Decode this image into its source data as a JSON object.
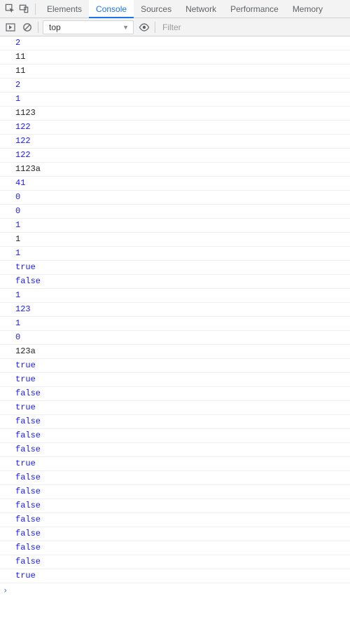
{
  "tabs": {
    "elements": "Elements",
    "console": "Console",
    "sources": "Sources",
    "network": "Network",
    "performance": "Performance",
    "memory": "Memory",
    "active": "console"
  },
  "toolbar": {
    "context_label": "top",
    "filter_placeholder": "Filter"
  },
  "log": [
    {
      "type": "number",
      "text": "2"
    },
    {
      "type": "string",
      "text": "11"
    },
    {
      "type": "string",
      "text": "11"
    },
    {
      "type": "number",
      "text": "2"
    },
    {
      "type": "number",
      "text": "1"
    },
    {
      "type": "string",
      "text": "1123"
    },
    {
      "type": "number",
      "text": "122"
    },
    {
      "type": "number",
      "text": "122"
    },
    {
      "type": "number",
      "text": "122"
    },
    {
      "type": "string",
      "text": "1123a"
    },
    {
      "type": "number",
      "text": "41"
    },
    {
      "type": "number",
      "text": "0"
    },
    {
      "type": "number",
      "text": "0"
    },
    {
      "type": "number",
      "text": "1"
    },
    {
      "type": "string",
      "text": "1"
    },
    {
      "type": "number",
      "text": "1"
    },
    {
      "type": "boolean",
      "text": "true"
    },
    {
      "type": "boolean",
      "text": "false"
    },
    {
      "type": "number",
      "text": "1"
    },
    {
      "type": "number",
      "text": "123"
    },
    {
      "type": "number",
      "text": "1"
    },
    {
      "type": "number",
      "text": "0"
    },
    {
      "type": "string",
      "text": "123a"
    },
    {
      "type": "boolean",
      "text": "true"
    },
    {
      "type": "boolean",
      "text": "true"
    },
    {
      "type": "boolean",
      "text": "false"
    },
    {
      "type": "boolean",
      "text": "true"
    },
    {
      "type": "boolean",
      "text": "false"
    },
    {
      "type": "boolean",
      "text": "false"
    },
    {
      "type": "boolean",
      "text": "false"
    },
    {
      "type": "boolean",
      "text": "true"
    },
    {
      "type": "boolean",
      "text": "false"
    },
    {
      "type": "boolean",
      "text": "false"
    },
    {
      "type": "boolean",
      "text": "false"
    },
    {
      "type": "boolean",
      "text": "false"
    },
    {
      "type": "boolean",
      "text": "false"
    },
    {
      "type": "boolean",
      "text": "false"
    },
    {
      "type": "boolean",
      "text": "false"
    },
    {
      "type": "boolean",
      "text": "true"
    }
  ],
  "colors": {
    "accent": "#1a73e8",
    "value_blue": "#1a1aff",
    "border": "#d0d0d0"
  }
}
